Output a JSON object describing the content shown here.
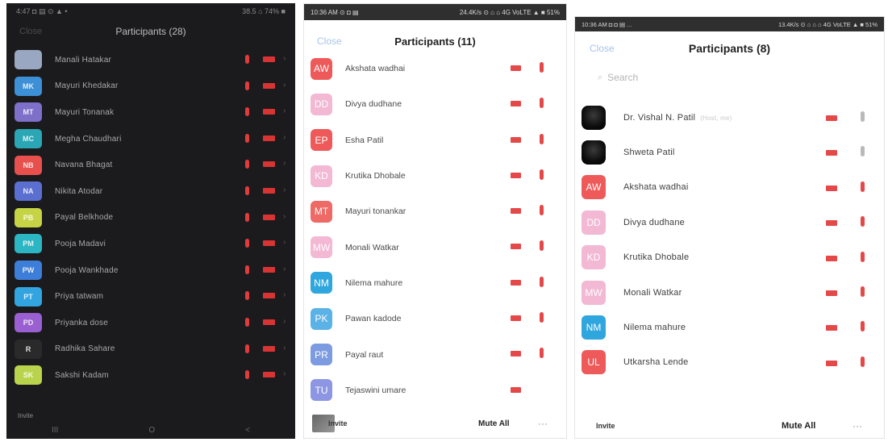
{
  "panel1": {
    "title": "Participants (28)",
    "close_label": "Close",
    "status_left": "4:47 ◘ ▤ ⊙ ▲ •",
    "status_right": "38.5 ⌂ 74% ■",
    "participants": [
      {
        "initials": "",
        "name": "Manali Hatakar",
        "color": "#9aa7c2"
      },
      {
        "initials": "MK",
        "name": "Mayuri Khedakar",
        "color": "#3d8fd6"
      },
      {
        "initials": "MT",
        "name": "Mayuri Tonanak",
        "color": "#7e6fc9"
      },
      {
        "initials": "MC",
        "name": "Megha Chaudhari",
        "color": "#2aa6b5"
      },
      {
        "initials": "NB",
        "name": "Navana Bhagat",
        "color": "#e8504e"
      },
      {
        "initials": "NA",
        "name": "Nikita Atodar",
        "color": "#5b6fd1"
      },
      {
        "initials": "PB",
        "name": "Payal Belkhode",
        "color": "#c6d345"
      },
      {
        "initials": "PM",
        "name": "Pooja Madavi",
        "color": "#2cb6c4"
      },
      {
        "initials": "PW",
        "name": "Pooja Wankhade",
        "color": "#3d7ed8"
      },
      {
        "initials": "PT",
        "name": "Priya tatwam",
        "color": "#32a4e0"
      },
      {
        "initials": "PD",
        "name": "Priyanka dose",
        "color": "#9a5fd0"
      },
      {
        "initials": "R",
        "name": "Radhika Sahare",
        "color": "#2a2a2a"
      },
      {
        "initials": "SK",
        "name": "Sakshi Kadam",
        "color": "#b9d44c"
      }
    ],
    "invite_label": "Invite",
    "nav": [
      "III",
      "O",
      "<"
    ]
  },
  "panel2": {
    "title": "Participants (11)",
    "close_label": "Close",
    "status_left": "10:36 AM ⊙ ◘ ▤",
    "status_right": "24.4K/s ⊙ ⌂ ⌂ 4G VoLTE ▲ ■ 51%",
    "participants": [
      {
        "initials": "AW",
        "name": "Akshata wadhai",
        "color": "#ee5a5a",
        "mic": true
      },
      {
        "initials": "DD",
        "name": "Divya dudhane",
        "color": "#f2b8d4",
        "mic": true
      },
      {
        "initials": "EP",
        "name": "Esha Patil",
        "color": "#ee5a5a",
        "mic": true
      },
      {
        "initials": "KD",
        "name": "Krutika Dhobale",
        "color": "#f2b8d4",
        "mic": true
      },
      {
        "initials": "MT",
        "name": "Mayuri tonankar",
        "color": "#ee6a66",
        "mic": true
      },
      {
        "initials": "MW",
        "name": "Monali Watkar",
        "color": "#f2b8d4",
        "mic": true
      },
      {
        "initials": "NM",
        "name": "Nilema mahure",
        "color": "#2fa6dd",
        "mic": true
      },
      {
        "initials": "PK",
        "name": "Pawan kadode",
        "color": "#5bb2e6",
        "mic": true
      },
      {
        "initials": "PR",
        "name": "Payal raut",
        "color": "#7c9be0",
        "mic": true
      },
      {
        "initials": "TU",
        "name": "Tejaswini umare",
        "color": "#8c96e2",
        "mic": false
      }
    ],
    "invite_label": "Invite",
    "mute_all_label": "Mute All",
    "more_label": "···"
  },
  "panel3": {
    "title": "Participants (8)",
    "close_label": "Close",
    "search_placeholder": "Search",
    "status_left": "10:36 AM ◘ ◘ ▤ ...",
    "status_right": "13.4K/s ⊙ ⌂ ⌂ ⌂ 4G VoLTE ▲ ■ 51%",
    "participants": [
      {
        "initials": "",
        "name": "Dr. Vishal N. Patil",
        "sub": "(Host, me)",
        "color": "#000000",
        "photo": true,
        "mic": "grey"
      },
      {
        "initials": "",
        "name": "Shweta Patil",
        "sub": "",
        "color": "#000000",
        "photo": true,
        "mic": "grey"
      },
      {
        "initials": "AW",
        "name": "Akshata wadhai",
        "sub": "",
        "color": "#ee5a5a",
        "photo": false,
        "mic": "red"
      },
      {
        "initials": "DD",
        "name": "Divya dudhane",
        "sub": "",
        "color": "#f2b8d4",
        "photo": false,
        "mic": "red"
      },
      {
        "initials": "KD",
        "name": "Krutika Dhobale",
        "sub": "",
        "color": "#f2b8d4",
        "photo": false,
        "mic": "red"
      },
      {
        "initials": "MW",
        "name": "Monali Watkar",
        "sub": "",
        "color": "#f2b8d4",
        "photo": false,
        "mic": "red"
      },
      {
        "initials": "NM",
        "name": "Nilema mahure",
        "sub": "",
        "color": "#2fa6dd",
        "photo": false,
        "mic": "red"
      },
      {
        "initials": "UL",
        "name": "Utkarsha Lende",
        "sub": "",
        "color": "#ee5a5a",
        "photo": false,
        "mic": "red"
      }
    ],
    "invite_label": "Invite",
    "mute_all_label": "Mute All",
    "more_label": "···"
  }
}
